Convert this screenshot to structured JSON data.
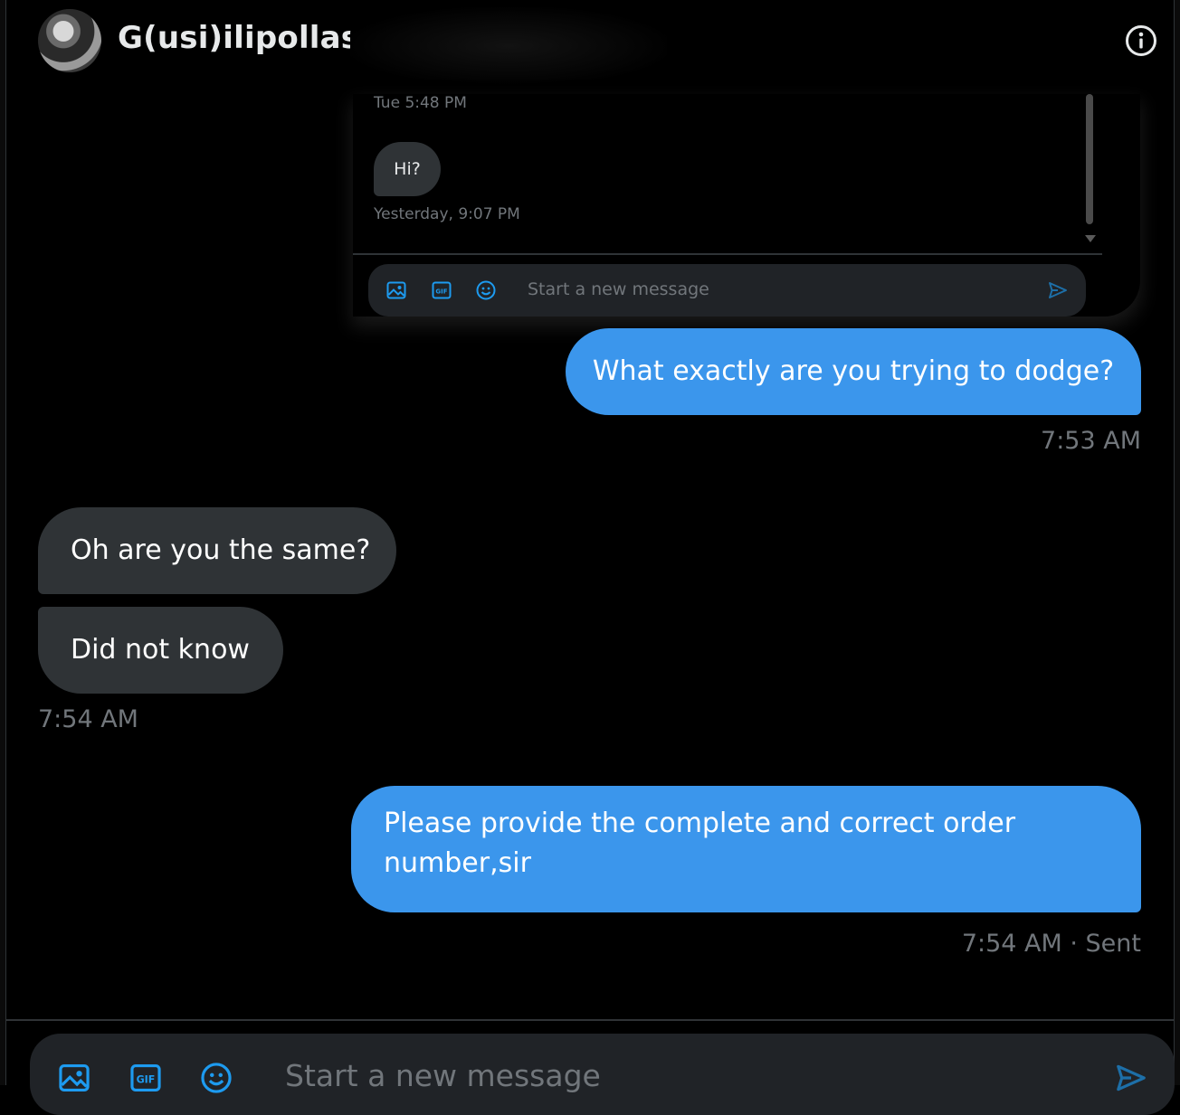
{
  "header": {
    "contact_name": "G(usi)ilipollas",
    "info_icon": "info-icon"
  },
  "embedded": {
    "timestamp_1": "Tue 5:48 PM",
    "message": "Hi?",
    "timestamp_2": "Yesterday, 9:07 PM",
    "composer_placeholder": "Start a new message",
    "icons": [
      "image-icon",
      "gif-icon",
      "emoji-icon",
      "send-icon"
    ]
  },
  "messages": [
    {
      "direction": "outgoing",
      "text": "What exactly are you trying to dodge?",
      "time": "7:53 AM"
    },
    {
      "direction": "incoming",
      "text": "Oh are you the same?"
    },
    {
      "direction": "incoming",
      "text": "Did not know",
      "time": "7:54 AM"
    },
    {
      "direction": "outgoing",
      "text": "Please provide the complete and correct order number,sir",
      "time": "7:54 AM · Sent"
    }
  ],
  "composer": {
    "placeholder": "Start a new message",
    "icons": [
      "image-icon",
      "gif-icon",
      "emoji-icon",
      "send-icon"
    ]
  },
  "colors": {
    "accent": "#1d9bf0",
    "outgoing_bubble": "#3b96ec",
    "incoming_bubble": "#2f3336",
    "muted_text": "#71767b",
    "background": "#000000"
  }
}
